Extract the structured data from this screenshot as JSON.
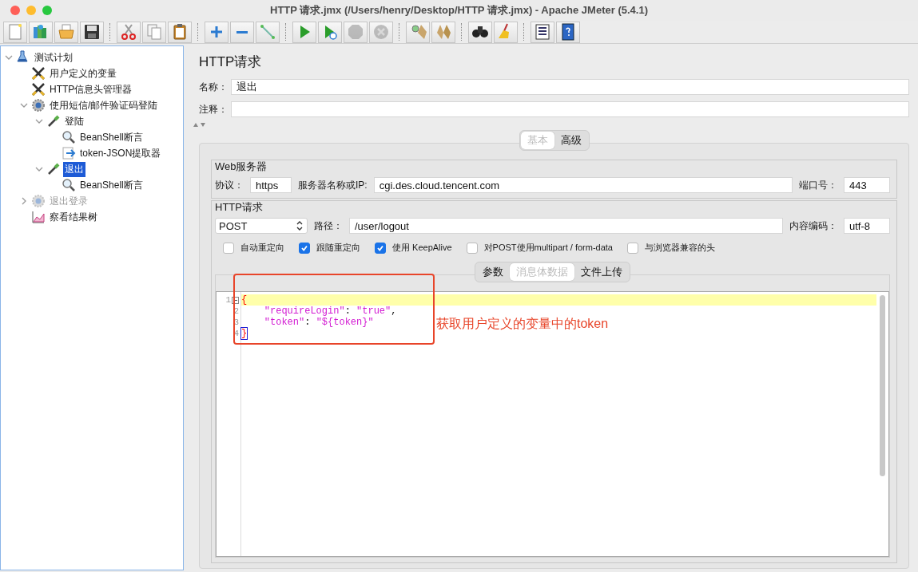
{
  "window": {
    "title": "HTTP 请求.jmx (/Users/henry/Desktop/HTTP 请求.jmx) - Apache JMeter (5.4.1)"
  },
  "toolbar": [
    [
      {
        "kind": "new",
        "disabled": false
      },
      {
        "kind": "templates",
        "disabled": false
      },
      {
        "kind": "open",
        "disabled": false
      },
      {
        "kind": "save",
        "disabled": false
      }
    ],
    [
      {
        "kind": "cut",
        "disabled": false
      },
      {
        "kind": "copy",
        "disabled": false
      },
      {
        "kind": "paste",
        "disabled": false
      }
    ],
    [
      {
        "kind": "expand",
        "disabled": false
      },
      {
        "kind": "collapse",
        "disabled": false
      },
      {
        "kind": "toggle",
        "disabled": false
      }
    ],
    [
      {
        "kind": "start",
        "disabled": false
      },
      {
        "kind": "start-no-pause",
        "disabled": false
      },
      {
        "kind": "stop",
        "disabled": true
      },
      {
        "kind": "shutdown",
        "disabled": true
      }
    ],
    [
      {
        "kind": "clear",
        "disabled": false
      },
      {
        "kind": "clear-all",
        "disabled": false
      }
    ],
    [
      {
        "kind": "search",
        "disabled": false
      },
      {
        "kind": "reset-search",
        "disabled": false
      }
    ],
    [
      {
        "kind": "function-helper",
        "disabled": false
      },
      {
        "kind": "help",
        "disabled": false
      }
    ]
  ],
  "tree": [
    {
      "label": "测试计划",
      "kind": "flask",
      "expanded": true,
      "selected": false,
      "disabled": false,
      "children": [
        {
          "label": "用户定义的变量",
          "kind": "tools",
          "selected": false,
          "disabled": false
        },
        {
          "label": "HTTP信息头管理器",
          "kind": "tools",
          "selected": false,
          "disabled": false
        },
        {
          "label": "使用短信/邮件验证码登陆",
          "kind": "gear",
          "expanded": true,
          "selected": false,
          "disabled": false,
          "children": [
            {
              "label": "登陆",
              "kind": "pipette",
              "expanded": true,
              "selected": false,
              "disabled": false,
              "children": [
                {
                  "label": "BeanShell断言",
                  "kind": "magnifier",
                  "selected": false,
                  "disabled": false
                },
                {
                  "label": "token-JSON提取器",
                  "kind": "extractor",
                  "selected": false,
                  "disabled": false
                }
              ]
            },
            {
              "label": "退出",
              "kind": "pipette",
              "expanded": true,
              "selected": true,
              "disabled": false,
              "children": [
                {
                  "label": "BeanShell断言",
                  "kind": "magnifier",
                  "selected": false,
                  "disabled": false
                }
              ]
            }
          ]
        },
        {
          "label": "退出登录",
          "kind": "gear",
          "expanded": false,
          "selected": false,
          "disabled": true
        },
        {
          "label": "察看结果树",
          "kind": "chart",
          "selected": false,
          "disabled": false
        }
      ]
    }
  ],
  "panel": {
    "title": "HTTP请求",
    "name_label": "名称：",
    "name_value": "退出",
    "comment_label": "注释："
  },
  "tabs": [
    {
      "label": "基本",
      "selected": true
    },
    {
      "label": "高级",
      "selected": false
    }
  ],
  "web_server": {
    "legend": "Web服务器",
    "protocol_label": "协议：",
    "protocol": "https",
    "server_label": "服务器名称或IP:",
    "server": "cgi.des.cloud.tencent.com",
    "port_label": "端口号：",
    "port": "443"
  },
  "http_request": {
    "legend": "HTTP请求",
    "method": "POST",
    "path_label": "路径：",
    "path": "/user/logout",
    "encoding_label": "内容编码：",
    "encoding": "utf-8",
    "options": [
      {
        "label": "自动重定向",
        "checked": false
      },
      {
        "label": "跟随重定向",
        "checked": true
      },
      {
        "label": "使用 KeepAlive",
        "checked": true
      },
      {
        "label": "对POST使用multipart / form-data",
        "checked": false
      },
      {
        "label": "与浏览器兼容的头",
        "checked": false
      }
    ]
  },
  "body_tabs": [
    {
      "label": "参数",
      "selected": false
    },
    {
      "label": "消息体数据",
      "selected": true
    },
    {
      "label": "文件上传",
      "selected": false
    }
  ],
  "editor": {
    "lines": [
      {
        "number": "1",
        "text": "{",
        "current": true,
        "fold": true,
        "bracket_match": false
      },
      {
        "number": "2",
        "text": "    \"requireLogin\": \"true\",",
        "current": false,
        "fold": false,
        "bracket_match": false
      },
      {
        "number": "3",
        "text": "    \"token\": \"${token}\"",
        "current": false,
        "fold": false,
        "bracket_match": false
      },
      {
        "number": "4",
        "text": "}",
        "current": false,
        "fold": false,
        "bracket_match": true
      }
    ]
  },
  "annotation": {
    "text": "获取用户定义的变量中的token"
  }
}
